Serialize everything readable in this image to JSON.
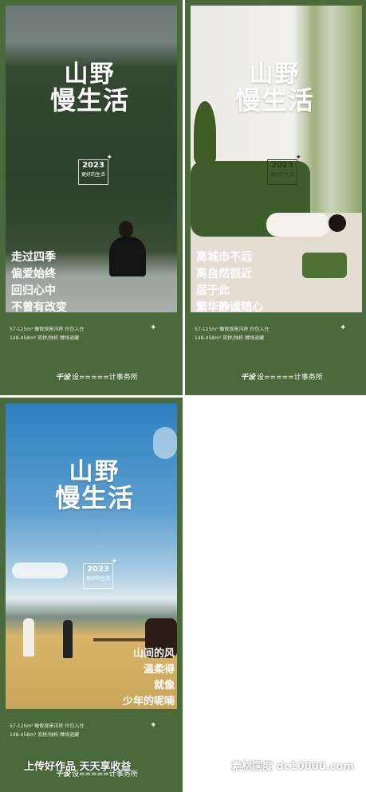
{
  "headline": {
    "line1": "山野",
    "line2": "慢生活"
  },
  "badge": {
    "year": "2023",
    "tagline": "更好的生活"
  },
  "posters": [
    {
      "verses": [
        "走过四季",
        "偏爱始终",
        "回归心中",
        "不曾有改变"
      ]
    },
    {
      "verses": [
        "离城市不远",
        "离自然很近",
        "居于此",
        "繁华静谧随心"
      ]
    },
    {
      "verses": [
        "山间的风",
        "温柔得",
        "就像",
        "少年的呢喃"
      ]
    }
  ],
  "specs": {
    "line1": "57-125m² 瞰攸观景洋房 拎包入住",
    "line2": "148-458m² 双拼/独栋 臻境退藏"
  },
  "credit": {
    "mark": "千设",
    "text": "设=====计事务所"
  },
  "watermarks": {
    "upload": "上传好作品  天天享收益",
    "site": "素材国度  dc10000.com"
  },
  "colors": {
    "green": "#4b6a3c",
    "sky": "#5a9bcc"
  }
}
